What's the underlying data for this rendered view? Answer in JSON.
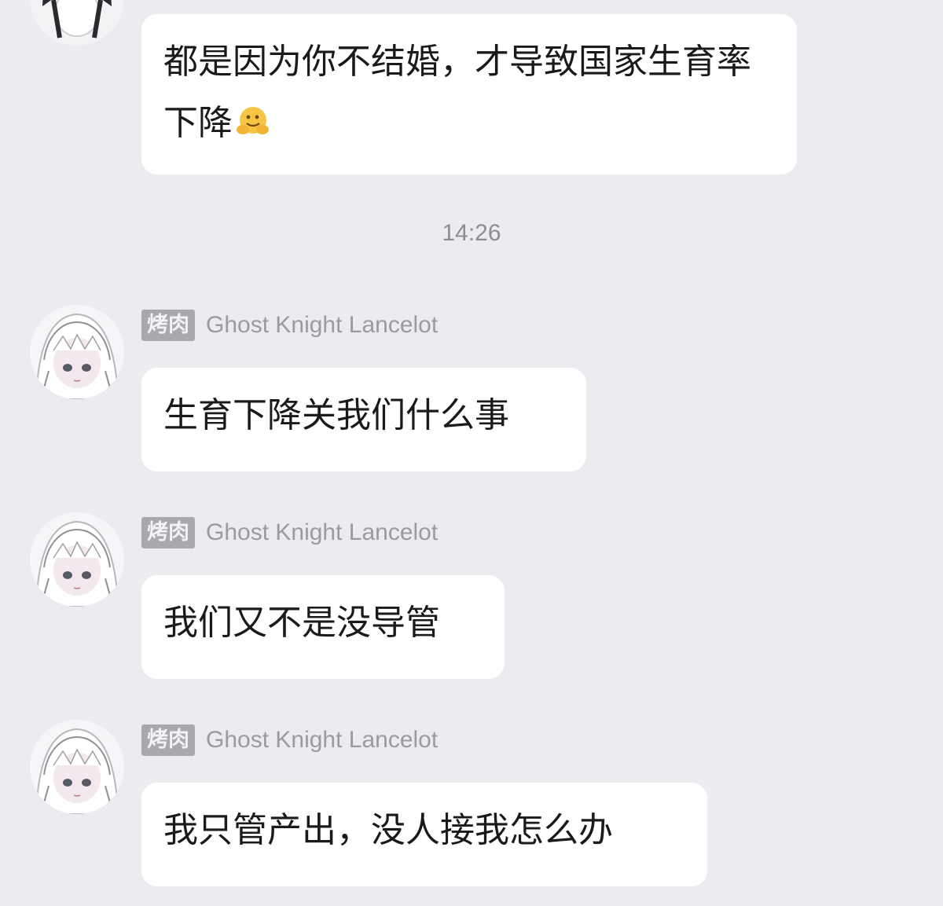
{
  "messages": [
    {
      "text": "都是因为你不结婚，才导致国家生育率下降",
      "emoji": "hugging-face-emoji"
    }
  ],
  "timestamp": "14:26",
  "group_messages": [
    {
      "tag": "烤肉",
      "sender": "Ghost Knight Lancelot",
      "text": "生育下降关我们什么事"
    },
    {
      "tag": "烤肉",
      "sender": "Ghost Knight Lancelot",
      "text": "我们又不是没导管"
    },
    {
      "tag": "烤肉",
      "sender": "Ghost Knight Lancelot",
      "text": "我只管产出，没人接我怎么办"
    }
  ],
  "colors": {
    "background": "#ecebf0",
    "bubble": "#ffffff",
    "tag": "#a8a8ae",
    "name": "#9a9aa0"
  }
}
